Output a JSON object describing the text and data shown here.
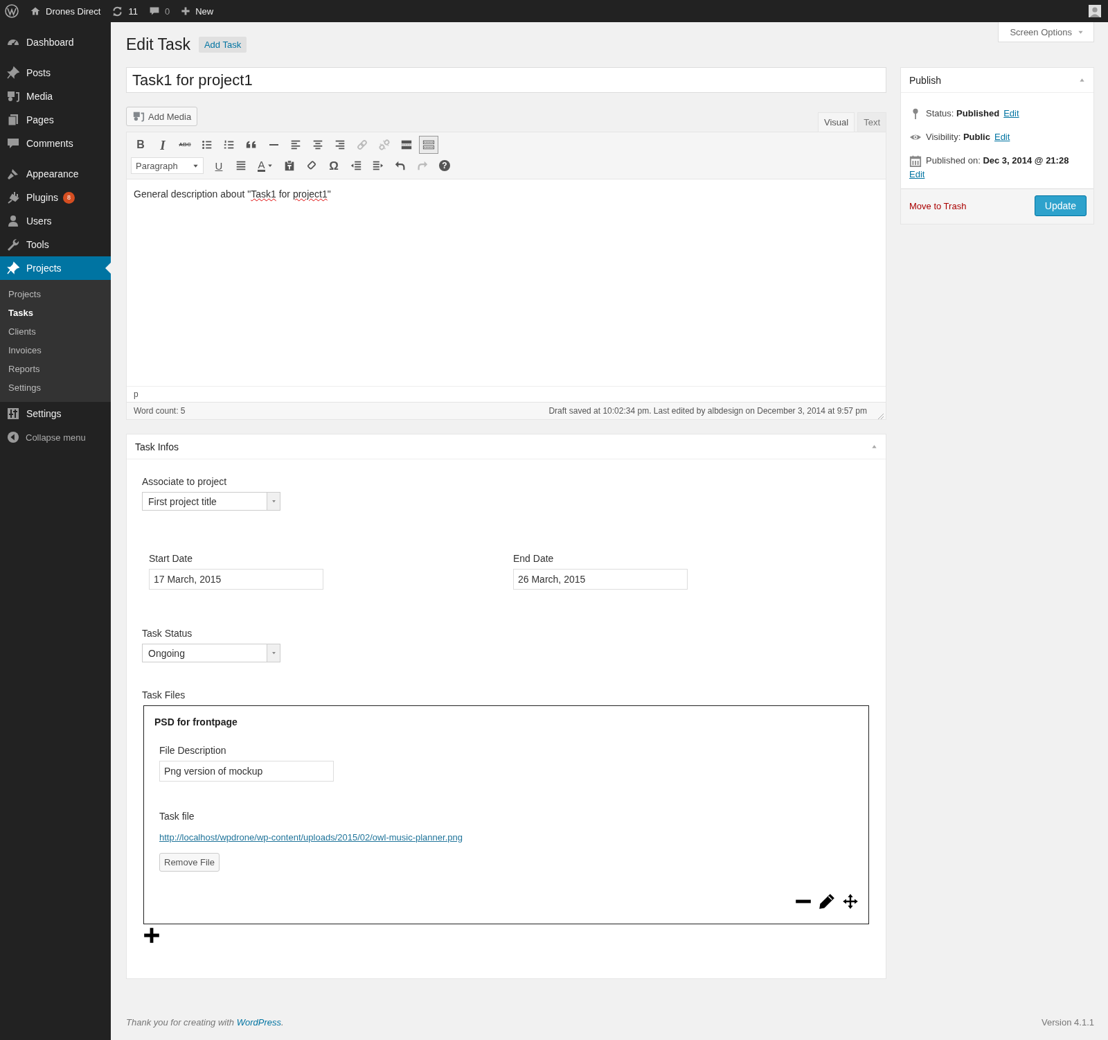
{
  "admin_bar": {
    "site_name": "Drones Direct",
    "updates": "11",
    "comments": "0",
    "new_label": "New"
  },
  "sidebar": {
    "items": [
      {
        "label": "Dashboard",
        "selected": false
      },
      {
        "label": "Posts",
        "selected": false
      },
      {
        "label": "Media",
        "selected": false
      },
      {
        "label": "Pages",
        "selected": false
      },
      {
        "label": "Comments",
        "selected": false
      },
      {
        "label": "Appearance",
        "selected": false
      },
      {
        "label": "Plugins",
        "selected": false,
        "badge": "8"
      },
      {
        "label": "Users",
        "selected": false
      },
      {
        "label": "Tools",
        "selected": false
      },
      {
        "label": "Projects",
        "selected": true,
        "children": [
          {
            "label": "Projects",
            "selected": false
          },
          {
            "label": "Tasks",
            "selected": true
          },
          {
            "label": "Clients",
            "selected": false
          },
          {
            "label": "Invoices",
            "selected": false
          },
          {
            "label": "Reports",
            "selected": false
          },
          {
            "label": "Settings",
            "selected": false
          }
        ]
      },
      {
        "label": "Settings",
        "selected": false
      }
    ],
    "collapse_label": "Collapse menu"
  },
  "screen_options": "Screen Options",
  "page_title": "Edit Task",
  "add_button": "Add Task",
  "post_title": "Task1 for project1",
  "editor": {
    "add_media": "Add Media",
    "tabs": [
      {
        "label": "Visual",
        "selected": true
      },
      {
        "label": "Text",
        "selected": false
      }
    ],
    "toolbar_rows": [
      [
        {
          "kind": "bold",
          "glyph": "B",
          "disabled": false,
          "selected": false
        },
        {
          "kind": "italic",
          "glyph": "I",
          "disabled": false,
          "selected": false
        },
        {
          "kind": "strike",
          "glyph": "ABC",
          "disabled": false,
          "selected": false
        },
        {
          "kind": "bullets",
          "disabled": false,
          "selected": false
        },
        {
          "kind": "numbers",
          "disabled": false,
          "selected": false
        },
        {
          "kind": "quote",
          "disabled": false,
          "selected": false
        },
        {
          "kind": "rule",
          "disabled": false,
          "selected": false
        },
        {
          "kind": "alignleft",
          "disabled": false,
          "selected": false
        },
        {
          "kind": "aligncenter",
          "disabled": false,
          "selected": false
        },
        {
          "kind": "alignright",
          "disabled": false,
          "selected": false
        },
        {
          "kind": "link",
          "disabled": true,
          "selected": false
        },
        {
          "kind": "unlink",
          "disabled": true,
          "selected": false
        },
        {
          "kind": "more",
          "disabled": false,
          "selected": false
        },
        {
          "kind": "sink",
          "disabled": false,
          "selected": true
        }
      ],
      [
        {
          "kind": "format",
          "value": "Paragraph"
        },
        {
          "kind": "underline",
          "glyph": "U",
          "disabled": false,
          "selected": false
        },
        {
          "kind": "justify",
          "disabled": false,
          "selected": false
        },
        {
          "kind": "color",
          "glyph": "A",
          "disabled": false,
          "selected": false
        },
        {
          "kind": "paste",
          "disabled": false,
          "selected": false
        },
        {
          "kind": "eraser",
          "disabled": false,
          "selected": false
        },
        {
          "kind": "omega",
          "glyph": "Ω",
          "disabled": false,
          "selected": false
        },
        {
          "kind": "outdent",
          "disabled": false,
          "selected": false
        },
        {
          "kind": "indent",
          "disabled": false,
          "selected": false
        },
        {
          "kind": "undo",
          "disabled": false,
          "selected": false
        },
        {
          "kind": "redo",
          "disabled": true,
          "selected": false
        },
        {
          "kind": "help",
          "glyph": "?",
          "disabled": false,
          "selected": false
        }
      ]
    ],
    "content": [
      {
        "text": "General description about \"",
        "misspelled": false
      },
      {
        "text": "Task1",
        "misspelled": true
      },
      {
        "text": " for ",
        "misspelled": false
      },
      {
        "text": "project1",
        "misspelled": true
      },
      {
        "text": "\"",
        "misspelled": false
      }
    ],
    "path": "p",
    "word_count": "Word count: 5",
    "draft_status": "Draft saved at 10:02:34 pm. Last edited by albdesign on December 3, 2014 at 9:57 pm"
  },
  "task_infos": {
    "title": "Task Infos",
    "project_label": "Associate to project",
    "project_value": "First project title",
    "start_label": "Start Date",
    "start_value": "17 March, 2015",
    "end_label": "End Date",
    "end_value": "26 March, 2015",
    "status_label": "Task Status",
    "status_value": "Ongoing",
    "files_label": "Task Files",
    "files": [
      {
        "title": "PSD for frontpage",
        "description_label": "File Description",
        "description_value": "Png version of mockup",
        "file_label": "Task file",
        "file_url": "http://localhost/wpdrone/wp-content/uploads/2015/02/owl-music-planner.png",
        "remove_button": "Remove File"
      }
    ]
  },
  "publish": {
    "title": "Publish",
    "rows": [
      {
        "text": "Status: **Published**",
        "edit": "Edit"
      },
      {
        "text": "Visibility: **Public**",
        "edit": "Edit"
      },
      {
        "text": "Published on: **Dec 3, 2014 @ 21:28**",
        "edit": "Edit"
      }
    ],
    "trash": "Move to Trash",
    "update": "Update"
  },
  "footer": {
    "text": "Thank you for creating with ",
    "link": "WordPress",
    "after": ".",
    "version": "Version 4.1.1"
  }
}
